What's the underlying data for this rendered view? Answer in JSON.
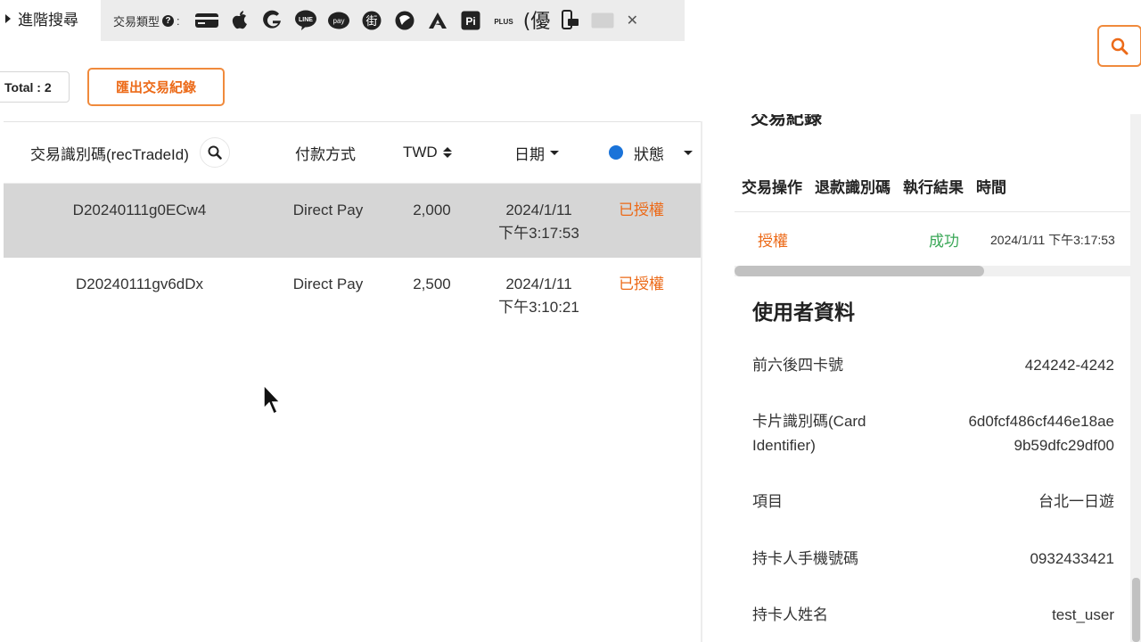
{
  "filter": {
    "advanced_search_label": "進階搜尋",
    "payment_type_label": "交易類型",
    "payment_type_colon": ":",
    "payment_icons": [
      "credit-card",
      "apple-pay",
      "google-pay",
      "line-pay",
      "samsung-pay",
      "jko-pay",
      "easy-wallet",
      "atome",
      "pi-wallet",
      "plus-pay",
      "easy-card",
      "card-reader",
      "disabled-method"
    ],
    "line_icon_text": "LINE",
    "samsung_icon_text": "pay",
    "jko_icon_text": "街",
    "pi_icon_text": "Pi",
    "plus_icon_text": "PLUS",
    "easy_icon_text": "(優"
  },
  "toolbar": {
    "total_label": "Total : 2",
    "export_label": "匯出交易紀錄"
  },
  "table": {
    "headers": {
      "trade_id": "交易識別碼(recTradeId)",
      "payment_method": "付款方式",
      "currency": "TWD",
      "date": "日期",
      "status": "狀態"
    },
    "rows": [
      {
        "id": "D20240111g0ECw4",
        "method": "Direct Pay",
        "amount": "2,000",
        "date": "2024/1/11",
        "time": "下午3:17:53",
        "status": "已授權"
      },
      {
        "id": "D20240111gv6dDx",
        "method": "Direct Pay",
        "amount": "2,500",
        "date": "2024/1/11",
        "time": "下午3:10:21",
        "status": "已授權"
      }
    ]
  },
  "detail": {
    "cut_heading": "交易紀錄",
    "log_headers": [
      "交易操作",
      "退款識別碼",
      "執行結果",
      "時間"
    ],
    "log_row": {
      "operation": "授權",
      "result": "成功",
      "time": "2024/1/11 下午3:17:53"
    },
    "user_section_title": "使用者資料",
    "fields": [
      {
        "label": "前六後四卡號",
        "value": "424242-4242"
      },
      {
        "label": "卡片識別碼(Card",
        "label2": "Identifier)",
        "value": "6d0fcf486cf446e18ae",
        "value2": "9b59dfc29df00"
      },
      {
        "label": "項目",
        "value": "台北一日遊"
      },
      {
        "label": "持卡人手機號碼",
        "value": "0932433421"
      },
      {
        "label": "持卡人姓名",
        "value": "test_user"
      }
    ]
  },
  "colors": {
    "accent": "#ec6a18",
    "success": "#3aa757",
    "status_dot": "#1a73d9",
    "selected_row": "#d6d6d6"
  }
}
